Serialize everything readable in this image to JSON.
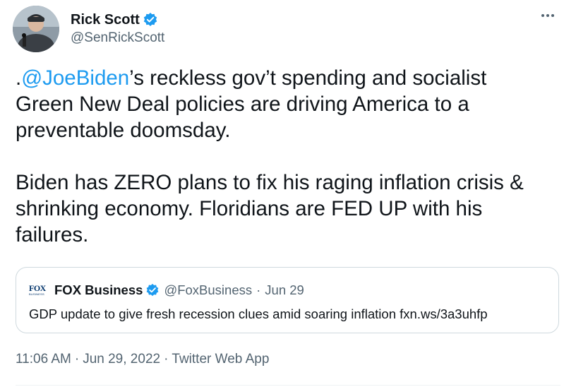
{
  "author": {
    "display_name": "Rick Scott",
    "handle": "@SenRickScott",
    "verified": true,
    "avatar_icon": "avatar-photo"
  },
  "more_icon": "more-horizontal-icon",
  "tweet": {
    "mention": "@JoeBiden",
    "line1_prefix": ".",
    "line1_rest": "’s reckless gov’t spending and socialist",
    "line2": "Green New Deal policies are driving America to a",
    "line3": "preventable doomsday.",
    "para2_line1": "Biden has ZERO plans to fix his raging inflation crisis &",
    "para2_line2": "shrinking economy. Floridians are FED UP with his",
    "para2_line3": "failures."
  },
  "quoted_tweet": {
    "logo_text": "FOX",
    "logo_subtext": "BUSINESS",
    "display_name": "FOX Business",
    "verified": true,
    "handle": "@FoxBusiness",
    "separator": "·",
    "date": "Jun 29",
    "text": "GDP update to give fresh recession clues amid soaring inflation fxn.ws/3a3uhfp"
  },
  "footer": {
    "time": "11:06 AM",
    "separator": "·",
    "date": "Jun 29, 2022",
    "source": "Twitter Web App"
  },
  "colors": {
    "link": "#1d9bf0",
    "secondary_text": "#536471",
    "primary_text": "#0f1419",
    "border": "#cfd9de",
    "verified_badge": "#1d9bf0"
  }
}
